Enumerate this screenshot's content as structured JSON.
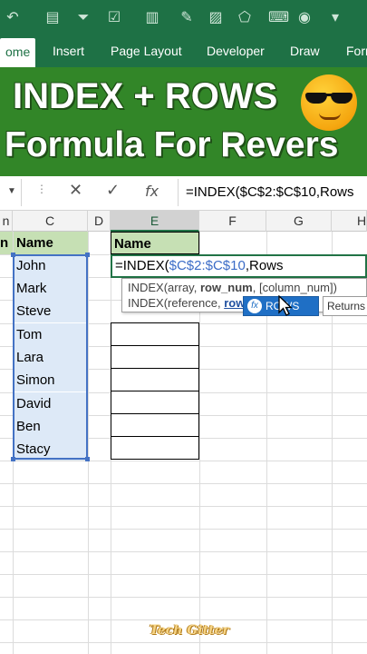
{
  "quick_access": {
    "icons": [
      "undo-icon",
      "table-icon",
      "filter-icon",
      "checkbox-icon",
      "chart-icon",
      "pen-icon",
      "image-icon",
      "shape-icon",
      "camera-icon",
      "more-icon"
    ]
  },
  "ribbon": {
    "tabs": [
      {
        "label": "ome",
        "active": true
      },
      {
        "label": "Insert",
        "active": false
      },
      {
        "label": "Page Layout",
        "active": false
      },
      {
        "label": "Developer",
        "active": false
      },
      {
        "label": "Draw",
        "active": false
      },
      {
        "label": "Forr",
        "active": false
      }
    ]
  },
  "banner": {
    "line1": "INDEX + ROWS",
    "line2": "Formula For Revers",
    "emoji": "cool-face-sunglasses"
  },
  "formula_bar": {
    "cancel_symbol": "✕",
    "enter_symbol": "✓",
    "fx_label": "fx",
    "formula": "=INDEX($C$2:$C$10,Rows"
  },
  "grid": {
    "columns": [
      "n",
      "C",
      "D",
      "E",
      "F",
      "G",
      "H"
    ],
    "selected_column": "E",
    "col_b_header": "n",
    "c_header": "Name",
    "names": [
      "John",
      "Mark",
      "Steve",
      "Tom",
      "Lara",
      "Simon",
      "David",
      "Ben",
      "Stacy"
    ],
    "e_header": "Name",
    "edit_cell": {
      "prefix": "=INDEX(",
      "ref": "$C$2:$C$10",
      "suffix": ",Rows"
    }
  },
  "tooltip": {
    "line1_pre": "INDEX(array, ",
    "line1_bold": "row_num",
    "line1_post": ", [column_num])",
    "line2_pre": "INDEX(reference, ",
    "line2_bold": "row"
  },
  "autocomplete": {
    "item": "ROWS",
    "description": "Returns"
  },
  "watermark": "Tech Gitter"
}
